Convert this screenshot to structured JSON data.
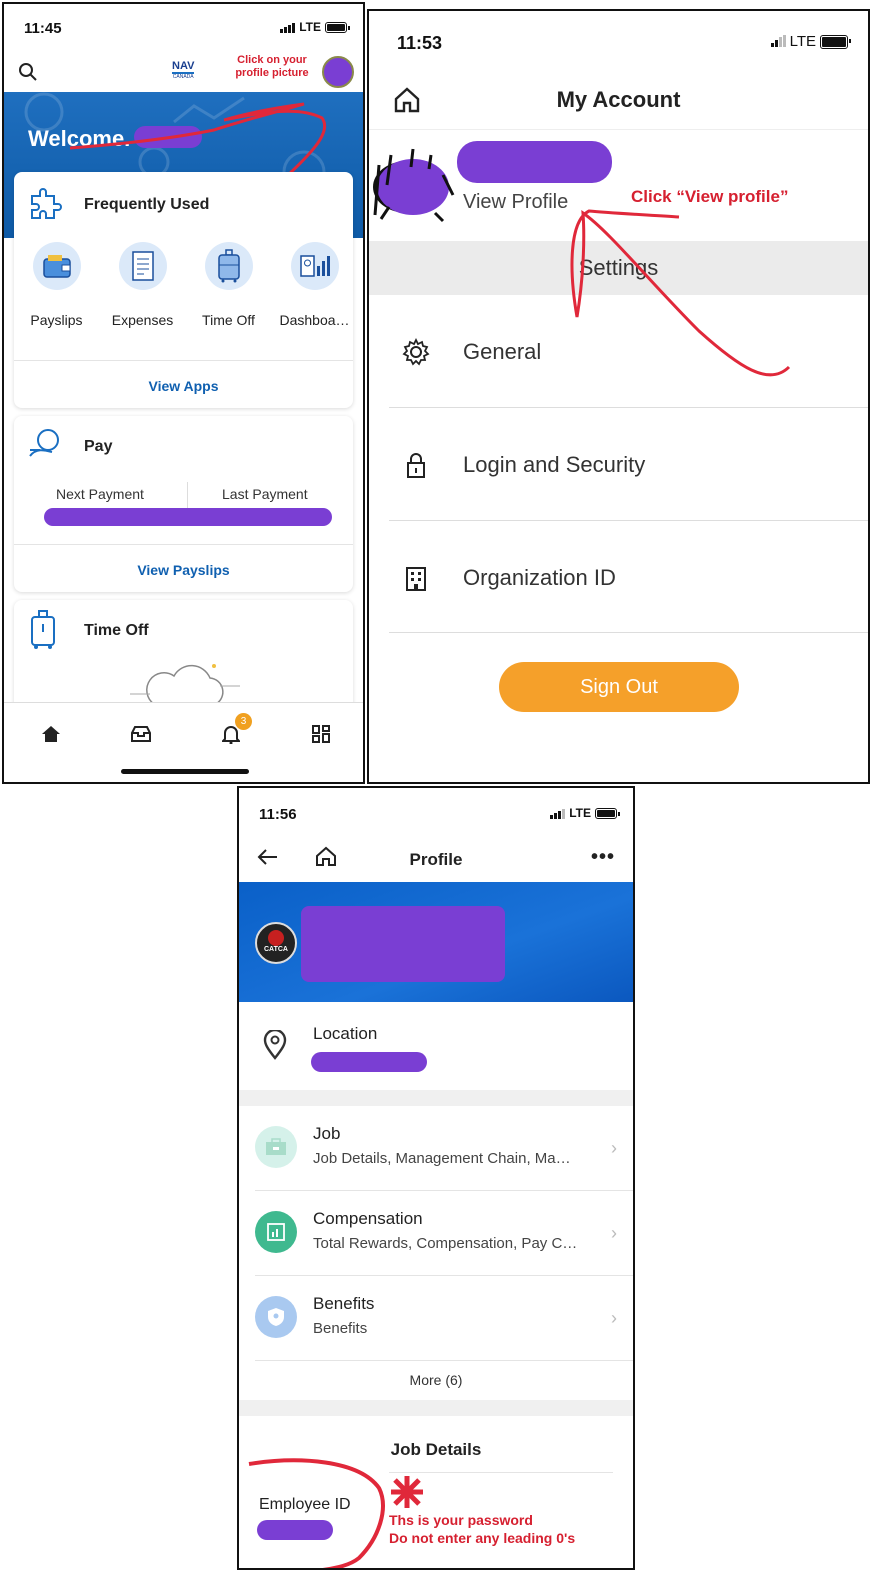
{
  "colors": {
    "brand_blue": "#1a6fc2",
    "purple_redaction": "#7a3ed3",
    "annotation_red": "#d62030",
    "sign_out_orange": "#f5a02a"
  },
  "screen1": {
    "time": "11:45",
    "network": "LTE",
    "logo_text": "NAV",
    "logo_sub": "CANADA",
    "annotation": "Click on your profile picture",
    "welcome": "Welcome.",
    "frequently_used": {
      "title": "Frequently Used",
      "apps": [
        {
          "label": "Payslips",
          "icon": "wallet-icon"
        },
        {
          "label": "Expenses",
          "icon": "receipt-icon"
        },
        {
          "label": "Time Off",
          "icon": "suitcase-icon"
        },
        {
          "label": "Dashboa…",
          "icon": "dashboard-icon"
        }
      ],
      "view_apps": "View Apps"
    },
    "pay": {
      "title": "Pay",
      "next_payment": "Next Payment",
      "last_payment": "Last Payment",
      "view_payslips": "View Payslips"
    },
    "time_off": {
      "title": "Time Off"
    },
    "notification_count": "3"
  },
  "screen2": {
    "time": "11:53",
    "network": "LTE",
    "title": "My Account",
    "view_profile": "View Profile",
    "annotation": "Click “View profile”",
    "settings_header": "Settings",
    "menu": [
      {
        "label": "General",
        "icon": "gear-icon"
      },
      {
        "label": "Login and Security",
        "icon": "lock-icon"
      },
      {
        "label": "Organization ID",
        "icon": "building-icon"
      }
    ],
    "sign_out": "Sign Out"
  },
  "screen3": {
    "time": "11:56",
    "network": "LTE",
    "title": "Profile",
    "avatar_text": "CATCA",
    "location_label": "Location",
    "sections": [
      {
        "title": "Job",
        "subtitle": "Job Details, Management Chain, Ma…",
        "icon": "briefcase-icon",
        "color": "#d5f1ea"
      },
      {
        "title": "Compensation",
        "subtitle": "Total Rewards, Compensation, Pay C…",
        "icon": "chart-icon",
        "color": "#3fb98f"
      },
      {
        "title": "Benefits",
        "subtitle": "Benefits",
        "icon": "shield-icon",
        "color": "#a9c9f0"
      }
    ],
    "more": "More (6)",
    "job_details_title": "Job Details",
    "employee_id_label": "Employee ID",
    "annotation_line1": "Ths is your password",
    "annotation_line2": "Do not enter any leading 0's"
  }
}
